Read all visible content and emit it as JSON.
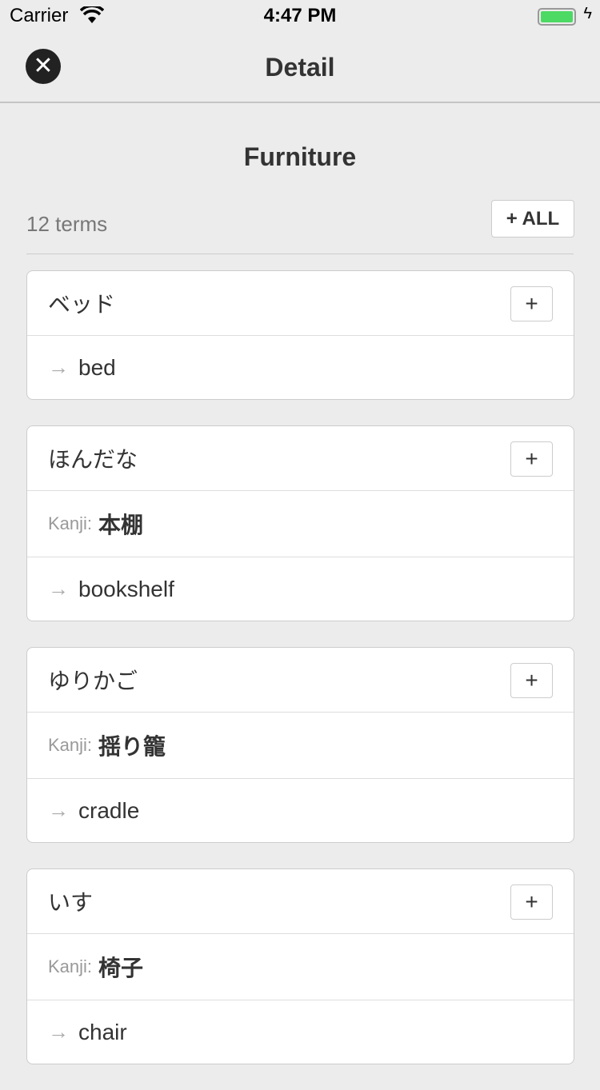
{
  "status": {
    "carrier": "Carrier",
    "time": "4:47 PM"
  },
  "nav": {
    "title": "Detail",
    "close_icon": "✕"
  },
  "set": {
    "title": "Furniture",
    "count": "12 terms",
    "add_all": "+ ALL"
  },
  "labels": {
    "kanji": "Kanji:",
    "plus": "+",
    "arrow": "→"
  },
  "cards": [
    {
      "term": "ベッド",
      "meaning": "bed"
    },
    {
      "term": "ほんだな",
      "kanji": "本棚",
      "meaning": "bookshelf"
    },
    {
      "term": "ゆりかご",
      "kanji": "揺り籠",
      "meaning": "cradle"
    },
    {
      "term": "いす",
      "kanji": "椅子",
      "meaning": "chair"
    }
  ]
}
